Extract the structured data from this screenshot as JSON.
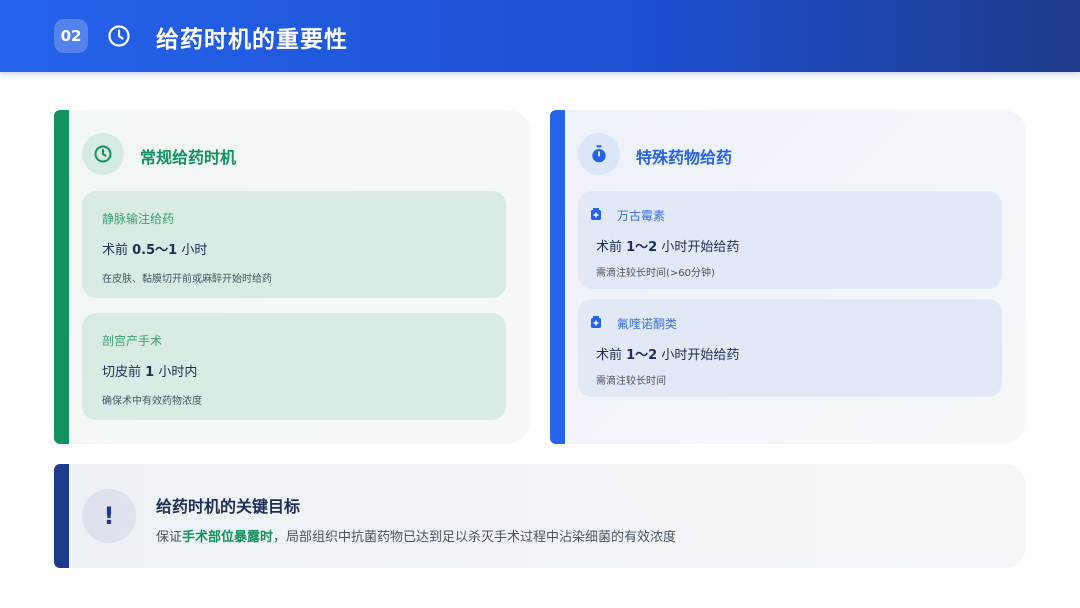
{
  "header": {
    "badge": "02",
    "title": "给药时机的重要性",
    "icon": "clock-icon"
  },
  "left_card": {
    "title": "常规给药时机",
    "icon": "clock-icon",
    "accent": "#12925f",
    "items": [
      {
        "label": "静脉输注给药",
        "main_prefix": "术前 ",
        "main_bold": "0.5～1",
        "main_suffix": " 小时",
        "note": "在皮肤、黏膜切开前或麻醉开始时给药"
      },
      {
        "label": "剖宫产手术",
        "main_prefix": "切皮前 ",
        "main_bold": "1",
        "main_suffix": " 小时内",
        "note": "确保术中有效药物浓度"
      }
    ]
  },
  "right_card": {
    "title": "特殊药物给药",
    "icon": "stopwatch-icon",
    "accent": "#2563eb",
    "items": [
      {
        "label": "万古霉素",
        "icon": "medicine-box-icon",
        "main_prefix": "术前 ",
        "main_bold": "1～2",
        "main_suffix": " 小时开始给药",
        "note": "需滴注较长时间(>60分钟)"
      },
      {
        "label": "氟喹诺酮类",
        "icon": "medicine-box-icon",
        "main_prefix": "术前 ",
        "main_bold": "1～2",
        "main_suffix": " 小时开始给药",
        "note": "需滴注较长时间"
      }
    ]
  },
  "goal": {
    "icon": "exclamation-icon",
    "title": "给药时机的关键目标",
    "text_prefix": "保证",
    "text_highlight": "手术部位暴露时",
    "text_suffix": "，局部组织中抗菌药物已达到足以杀灭手术过程中沾染细菌的有效浓度",
    "accent": "#1e3a8a"
  }
}
